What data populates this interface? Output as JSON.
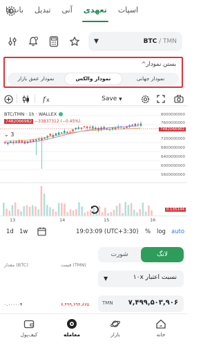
{
  "top_tabs": [
    {
      "label": "اسپات"
    },
    {
      "label": "تعهدی"
    },
    {
      "label": "آنی"
    },
    {
      "label": "تبدیل"
    },
    {
      "label": "بات‌ها"
    }
  ],
  "market": {
    "pair_base": "BTC",
    "pair_sep": " / ",
    "pair_quote": "TMN"
  },
  "chart_options": {
    "title": "بستن نمودار",
    "tabs": [
      {
        "label": "نمودار جهانی"
      },
      {
        "label": "نمودار والکس"
      },
      {
        "label": "نمودار عمق بازار"
      }
    ]
  },
  "toolbar": {
    "save_label": "Save"
  },
  "chart": {
    "legend_title": "BTC/TMN · 1h · WALLEX",
    "ohlc_left": "7482066982",
    "ohlc_change": "−33837312 (−0.45%)",
    "indicator_count": "3",
    "price_axis": [
      "8000000000",
      "7600000000",
      "7200000000",
      "6800000000",
      "6400000000",
      "6000000000",
      "5600000000"
    ],
    "last_price": "7482066982",
    "volume_value": "0.135144",
    "time_labels": [
      "13",
      "14",
      "15",
      "16"
    ]
  },
  "timeframe": {
    "tf_1d": "1d",
    "tf_1w": "1w",
    "clock": "19:03:09 (UTC+3:30)",
    "percent": "%",
    "log": "log",
    "auto": "auto"
  },
  "order": {
    "long_label": "لانگ",
    "short_label": "شورت",
    "leverage_label": "نسبت اعتبار ۱۰x",
    "price_unit": "TMN",
    "price_value": "۷,۴۹۹,۵۰۳,۹۰۶",
    "book_col_amount": "مقدار (BTC)",
    "book_col_price": "قیمت (TMN)",
    "book_row_price": "۷,۴۹۹,۲۹۴,۸۷۵",
    "book_row_amount": "۰.۰۰۰۰۰۴"
  },
  "bottom_nav": [
    {
      "label": "خانه"
    },
    {
      "label": "بازار"
    },
    {
      "label": "معامله"
    },
    {
      "label": "کیف‌پول"
    }
  ],
  "colors": {
    "accent": "#1f8a4c",
    "long": "#2e9d5b",
    "highlight": "#d9343a"
  }
}
